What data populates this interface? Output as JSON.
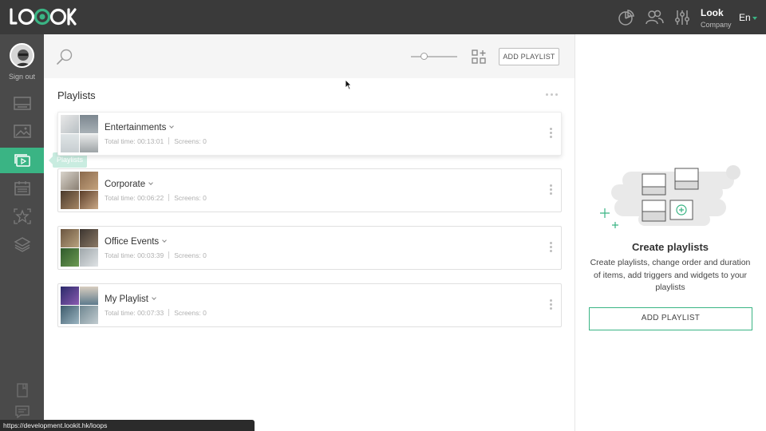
{
  "app": {
    "logo_text": "LOOK"
  },
  "header": {
    "account_name": "Look",
    "account_company": "Company",
    "language": "En",
    "icons": [
      "analytics-icon",
      "users-icon",
      "settings-sliders-icon"
    ]
  },
  "sidebar": {
    "sign_out_label": "Sign out",
    "items": [
      {
        "name": "screens",
        "icon": "screen-icon"
      },
      {
        "name": "media",
        "icon": "image-icon"
      },
      {
        "name": "playlists",
        "icon": "playlist-icon",
        "active": true
      },
      {
        "name": "schedule",
        "icon": "calendar-icon"
      },
      {
        "name": "widgets",
        "icon": "star-icon"
      },
      {
        "name": "layers",
        "icon": "layers-icon"
      }
    ],
    "tooltip": "Playlists",
    "bottom_icons": [
      "book-icon",
      "chat-icon"
    ]
  },
  "toolbar": {
    "add_playlist_label": "ADD PLAYLIST",
    "zoom_level": 0.25
  },
  "playlists": {
    "title": "Playlists",
    "items": [
      {
        "name": "Entertainments",
        "total_time": "Total time: 00:13:01",
        "screens": "Screens: 0"
      },
      {
        "name": "Corporate",
        "total_time": "Total time: 00:06:22",
        "screens": "Screens: 0"
      },
      {
        "name": "Office Events",
        "total_time": "Total time: 00:03:39",
        "screens": "Screens: 0"
      },
      {
        "name": "My Playlist",
        "total_time": "Total time: 00:07:33",
        "screens": "Screens: 0"
      }
    ]
  },
  "right_panel": {
    "title": "Create playlists",
    "description": "Create playlists, change order and duration of items, add triggers and widgets to your playlists",
    "add_playlist_label": "ADD PLAYLIST"
  },
  "statusbar": {
    "url": "https://development.lookit.hk/loops"
  },
  "colors": {
    "accent": "#3ab484",
    "topbar": "#3a3a3a",
    "sidebar": "#4a4a4a"
  }
}
